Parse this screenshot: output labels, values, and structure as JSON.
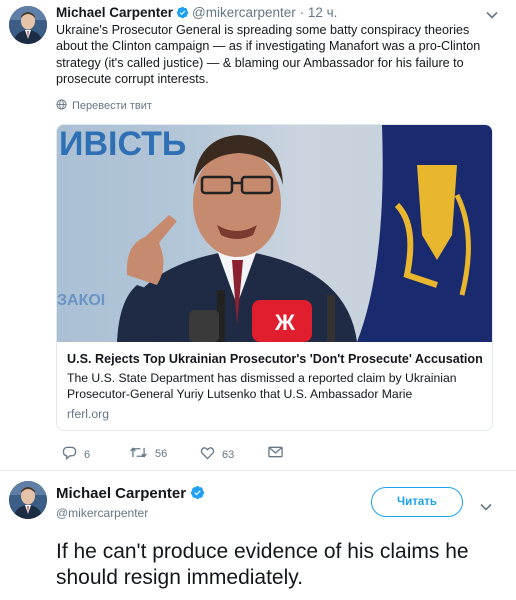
{
  "tweet": {
    "author_name": "Michael Carpenter",
    "handle": "@mikercarpenter",
    "separator": "·",
    "time": "12 ч.",
    "text": "Ukraine's Prosecutor General is spreading some batty conspiracy theories about the Clinton campaign — as if investigating Manafort was a pro-Clinton strategy (it's called justice) — & blaming our Ambassador for his failure to prosecute corrupt interests.",
    "translate_label": "Перевести твит",
    "card": {
      "image_sign_text": "ИВІСТЬ",
      "image_sign_text2": "ЗАКОІ",
      "title": "U.S. Rejects Top Ukrainian Prosecutor's 'Don't Prosecute' Accusation",
      "description": "The U.S. State Department has dismissed a reported claim by Ukrainian Prosecutor-General Yuriy Lutsenko that U.S. Ambassador Marie",
      "domain": "rferl.org"
    },
    "actions": {
      "replies": "6",
      "retweets": "56",
      "likes": "63"
    }
  },
  "reply": {
    "author_name": "Michael Carpenter",
    "handle": "@mikercarpenter",
    "follow_label": "Читать",
    "text": "If he can't produce evidence of his claims he should resign immediately."
  },
  "colors": {
    "accent": "#1da1f2",
    "secondary_text": "#657786",
    "border": "#e1e8ed"
  }
}
